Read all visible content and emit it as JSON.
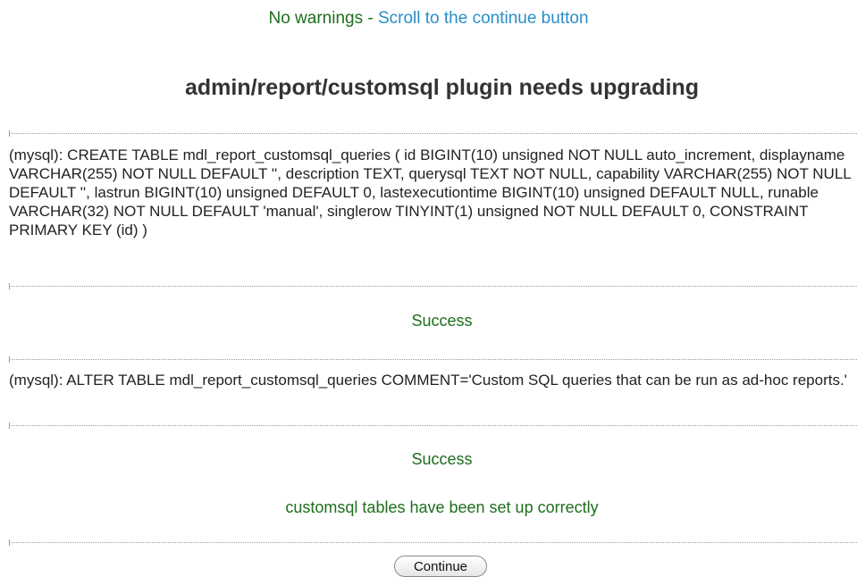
{
  "notice": {
    "text": "No warnings - ",
    "link": "Scroll to the continue button"
  },
  "heading": "admin/report/customsql plugin needs upgrading",
  "steps": [
    {
      "sql": "(mysql): CREATE TABLE mdl_report_customsql_queries ( id BIGINT(10) unsigned NOT NULL auto_increment, displayname VARCHAR(255) NOT NULL DEFAULT '', description TEXT, querysql TEXT NOT NULL, capability VARCHAR(255) NOT NULL DEFAULT '', lastrun BIGINT(10) unsigned DEFAULT 0, lastexecutiontime BIGINT(10) unsigned DEFAULT NULL, runable VARCHAR(32) NOT NULL DEFAULT 'manual', singlerow TINYINT(1) unsigned NOT NULL DEFAULT 0, CONSTRAINT PRIMARY KEY (id) )",
      "result": "Success"
    },
    {
      "sql": "(mysql): ALTER TABLE mdl_report_customsql_queries COMMENT='Custom SQL queries that can be run as ad-hoc reports.'",
      "result": "Success"
    }
  ],
  "summary": "customsql tables have been set up correctly",
  "continue_label": "Continue"
}
